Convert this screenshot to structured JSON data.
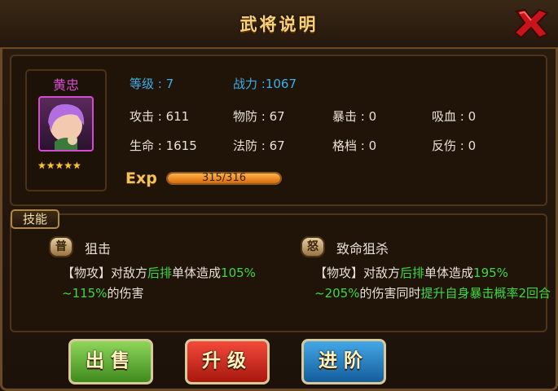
{
  "window": {
    "title": "武将说明",
    "close_icon": "close-x-icon"
  },
  "hero": {
    "name": "黄忠",
    "stars": "★★★★★",
    "level_label": "等级 : 7",
    "power_label": "战力 :1067",
    "stats": {
      "attack": "攻击 : 611",
      "phys_def": "物防 : 67",
      "crit": "暴击 : 0",
      "lifesteal": "吸血 : 0",
      "hp": "生命 : 1615",
      "magic_def": "法防 : 67",
      "block": "格档 : 0",
      "reflect": "反伤 : 0"
    },
    "exp": {
      "label": "Exp",
      "text": "315/316",
      "fraction": 0.997
    }
  },
  "skills": {
    "tag": "技能",
    "items": [
      {
        "badge": "普",
        "name": "狙击",
        "desc": [
          {
            "t": "【物攻】对敌方",
            "c": "w"
          },
          {
            "t": "后排",
            "c": "g"
          },
          {
            "t": "单体造成",
            "c": "w"
          },
          {
            "t": "105%",
            "c": "g"
          },
          {
            "t": "~115%",
            "c": "g"
          },
          {
            "t": "的伤害",
            "c": "w"
          }
        ]
      },
      {
        "badge": "怒",
        "name": "致命狙杀",
        "desc": [
          {
            "t": "【物攻】对敌方",
            "c": "w"
          },
          {
            "t": "后排",
            "c": "g"
          },
          {
            "t": "单体造成",
            "c": "w"
          },
          {
            "t": "195%",
            "c": "g"
          },
          {
            "t": "~205%",
            "c": "g"
          },
          {
            "t": "的伤害同时",
            "c": "w"
          },
          {
            "t": "提升自身暴击概率2回合",
            "c": "g"
          }
        ]
      }
    ]
  },
  "buttons": {
    "sell": "出售",
    "upgrade": "升级",
    "advance": "进阶"
  },
  "colors": {
    "accent_gold": "#f6d27a",
    "name_purple": "#d94bd4",
    "level_blue": "#3ab0e8",
    "highlight_green": "#3fd83f"
  }
}
